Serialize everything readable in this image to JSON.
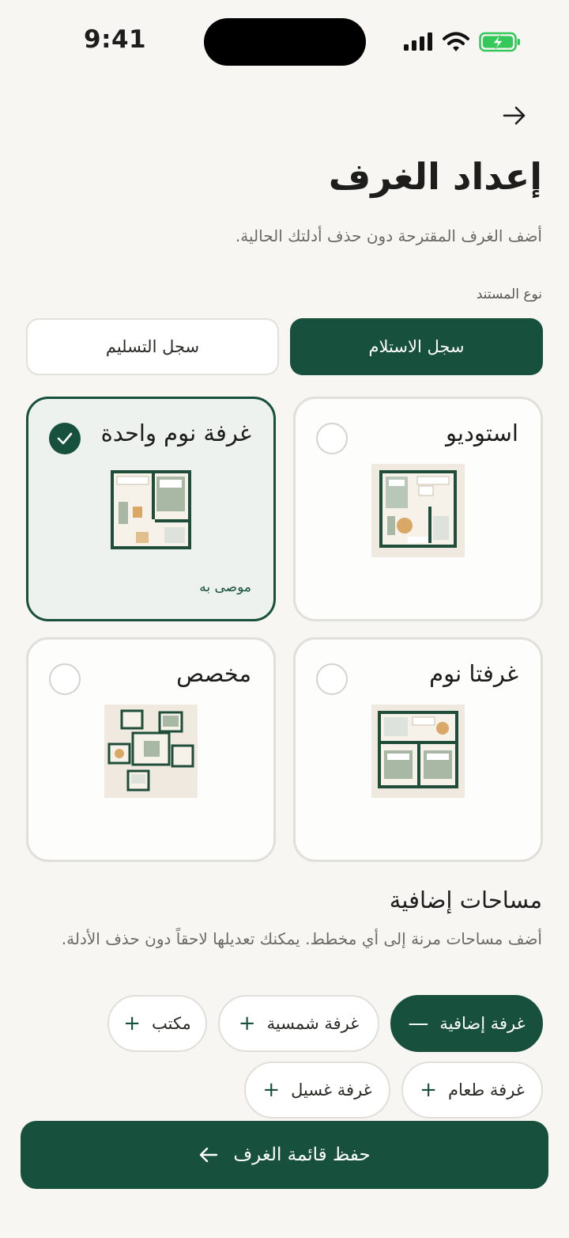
{
  "status": {
    "time": "9:41"
  },
  "header": {
    "title": "إعداد الغرف",
    "subtitle": "أضف الغرف المقترحة دون حذف أدلتك الحالية."
  },
  "document_type": {
    "label": "نوع المستند",
    "options": [
      "سجل الاستلام",
      "سجل التسليم"
    ],
    "selected": "سجل الاستلام"
  },
  "layouts": [
    {
      "title": "استوديو",
      "selected": false
    },
    {
      "title": "غرفة نوم واحدة",
      "selected": true,
      "badge": "موصى به"
    },
    {
      "title": "غرفتا نوم",
      "selected": false
    },
    {
      "title": "مخصص",
      "selected": false
    }
  ],
  "extra_spaces": {
    "title": "مساحات إضافية",
    "description": "أضف مساحات مرنة إلى أي مخطط. يمكنك تعديلها لاحقاً دون حذف الأدلة.",
    "chips": [
      {
        "label": "غرفة إضافية",
        "active": true
      },
      {
        "label": "غرفة شمسية",
        "active": false
      },
      {
        "label": "مكتب",
        "active": false
      },
      {
        "label": "غرفة طعام",
        "active": false
      },
      {
        "label": "غرفة غسيل",
        "active": false
      }
    ]
  },
  "save_button": {
    "label": "حفظ قائمة الغرف"
  },
  "icons": [
    "arrow-right-icon",
    "check-icon",
    "plus-icon",
    "minus-icon",
    "arrow-left-icon"
  ],
  "colors": {
    "primary": "#17503d",
    "background": "#f7f6f2",
    "battery": "#34c759"
  }
}
